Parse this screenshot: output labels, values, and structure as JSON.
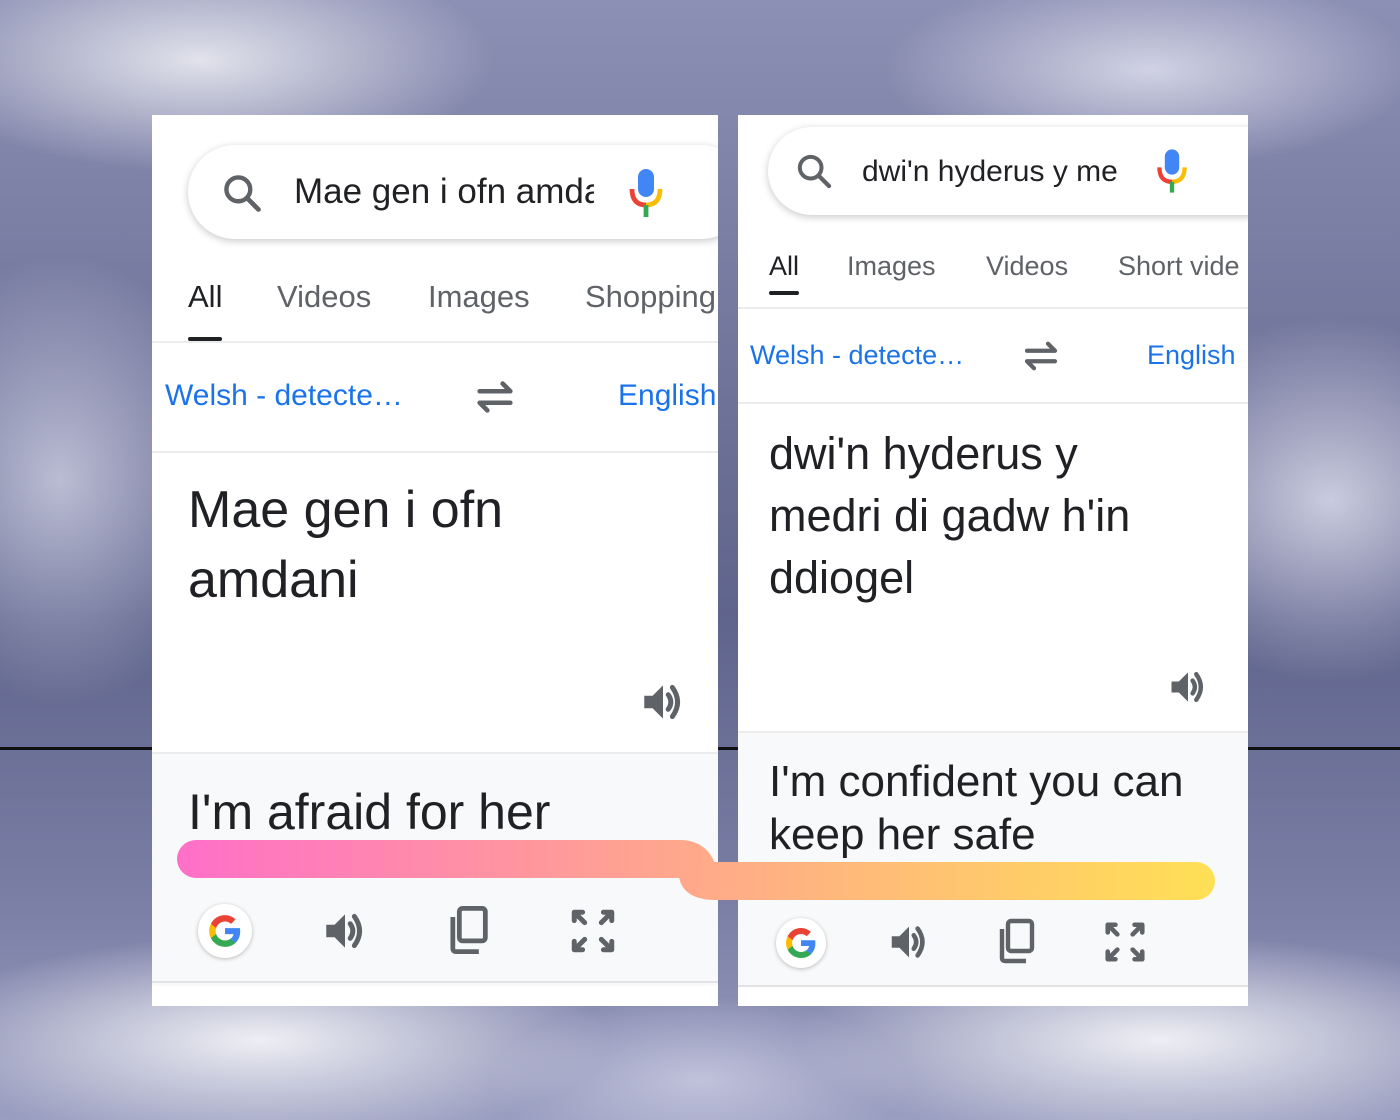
{
  "left_panel": {
    "search_query": "Mae gen i ofn amda",
    "tabs": [
      "All",
      "Videos",
      "Images",
      "Shopping"
    ],
    "source_lang": "Welsh - detecte…",
    "target_lang": "English",
    "source_text_line1": "Mae gen i ofn",
    "source_text_line2": "amdani",
    "translation": "I'm afraid for her"
  },
  "right_panel": {
    "search_query": "dwi'n hyderus y me",
    "tabs": [
      "All",
      "Images",
      "Videos",
      "Short vide"
    ],
    "source_lang": "Welsh - detecte…",
    "target_lang": "English",
    "source_text_line1": "dwi'n hyderus y",
    "source_text_line2": "medri di gadw h'in",
    "source_text_line3": "ddiogel",
    "translation_line1": "I'm confident you can",
    "translation_line2": "keep her safe"
  },
  "icons": {
    "search": "search-icon",
    "mic": "mic-icon",
    "swap": "swap-arrows-icon",
    "speaker": "speaker-icon",
    "google": "google-logo-icon",
    "copy": "copy-icon",
    "fullscreen": "fullscreen-icon"
  },
  "colors": {
    "link_blue": "#1a73e8",
    "text": "#202124",
    "muted": "#5f6368",
    "connector_start": "#ff6fc8",
    "connector_mid": "#ffa98a",
    "connector_end": "#ffe055"
  }
}
